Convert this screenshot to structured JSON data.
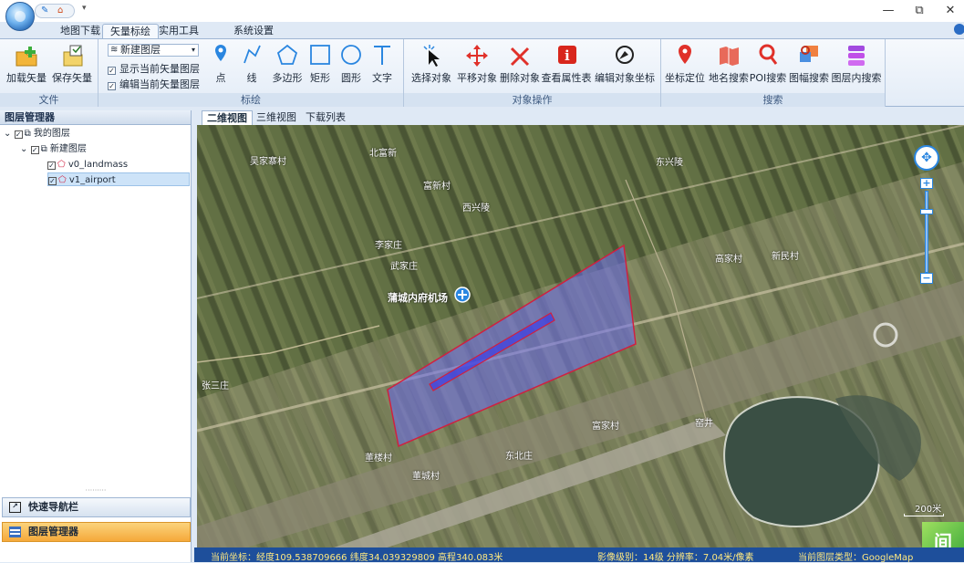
{
  "window": {
    "qat_icons": [
      "edit-icon",
      "home-icon"
    ],
    "minimize_glyph": "—",
    "restore_glyph": "⧉",
    "close_glyph": "✕"
  },
  "ribbon_tabs": [
    "地图下载",
    "矢量标绘",
    "实用工具",
    "系统设置"
  ],
  "ribbon": {
    "file_group": {
      "label": "文件",
      "buttons": [
        {
          "label": "加载矢量",
          "icon": "folder-add-icon"
        },
        {
          "label": "保存矢量",
          "icon": "folder-save-icon"
        }
      ]
    },
    "layer_selector": {
      "value": "新建图层"
    },
    "checkboxes": [
      {
        "label": "显示当前矢量图层",
        "checked": true
      },
      {
        "label": "编辑当前矢量图层",
        "checked": true
      }
    ],
    "draw_group": {
      "label": "标绘",
      "buttons": [
        {
          "label": "点",
          "icon": "pin-icon"
        },
        {
          "label": "线",
          "icon": "polyline-icon"
        },
        {
          "label": "多边形",
          "icon": "polygon-icon"
        },
        {
          "label": "矩形",
          "icon": "rectangle-icon"
        },
        {
          "label": "圆形",
          "icon": "circle-icon"
        },
        {
          "label": "文字",
          "icon": "text-icon"
        }
      ]
    },
    "object_group": {
      "label": "对象操作",
      "buttons": [
        {
          "label": "选择对象",
          "icon": "cursor-select-icon"
        },
        {
          "label": "平移对象",
          "icon": "move-icon"
        },
        {
          "label": "删除对象",
          "icon": "delete-icon"
        },
        {
          "label": "查看属性表",
          "icon": "info-icon"
        },
        {
          "label": "编辑对象坐标",
          "icon": "edit-coords-icon"
        }
      ]
    },
    "search_group": {
      "label": "搜索",
      "buttons": [
        {
          "label": "坐标定位",
          "icon": "location-pin-icon"
        },
        {
          "label": "地名搜索",
          "icon": "place-search-icon"
        },
        {
          "label": "POI搜索",
          "icon": "poi-search-icon"
        },
        {
          "label": "图幅搜索",
          "icon": "sheet-search-icon"
        },
        {
          "label": "图层内搜索",
          "icon": "layer-search-icon"
        }
      ]
    }
  },
  "layer_panel": {
    "title": "图层管理器",
    "tree": [
      {
        "label": "我的图层",
        "checked": true
      },
      {
        "label": "新建图层",
        "checked": true
      },
      {
        "label": "v0_landmass",
        "checked": true
      },
      {
        "label": "v1_airport",
        "checked": true,
        "selected": true
      }
    ],
    "nav_buttons": [
      "快速导航栏",
      "图层管理器"
    ],
    "splitter_dots": "·········"
  },
  "map_tabs": [
    "二维视图",
    "三维视图",
    "下载列表"
  ],
  "map": {
    "labels": [
      "吴家寨村",
      "北富新",
      "东兴陵",
      "富新村",
      "西兴陵",
      "李家庄",
      "武家庄",
      "蒲城内府机场",
      "高家村",
      "新民村",
      "张三庄",
      "富家村",
      "窑井",
      "董楼村",
      "东北庄",
      "董城村"
    ],
    "scale": "200米",
    "zoom_plus": "+",
    "zoom_minus": "−",
    "corner_logo": "间"
  },
  "status": {
    "coords": "当前坐标：经度109.538709666 纬度34.039329809 高程340.083米",
    "level": "影像级别：14级 分辨率：7.04米/像素",
    "layer_type": "当前图层类型：GoogleMap"
  },
  "colors": {
    "polygon_fill": "#6a6cf0",
    "polygon_stroke": "#d02040",
    "active_nav": "#f7b53c"
  }
}
